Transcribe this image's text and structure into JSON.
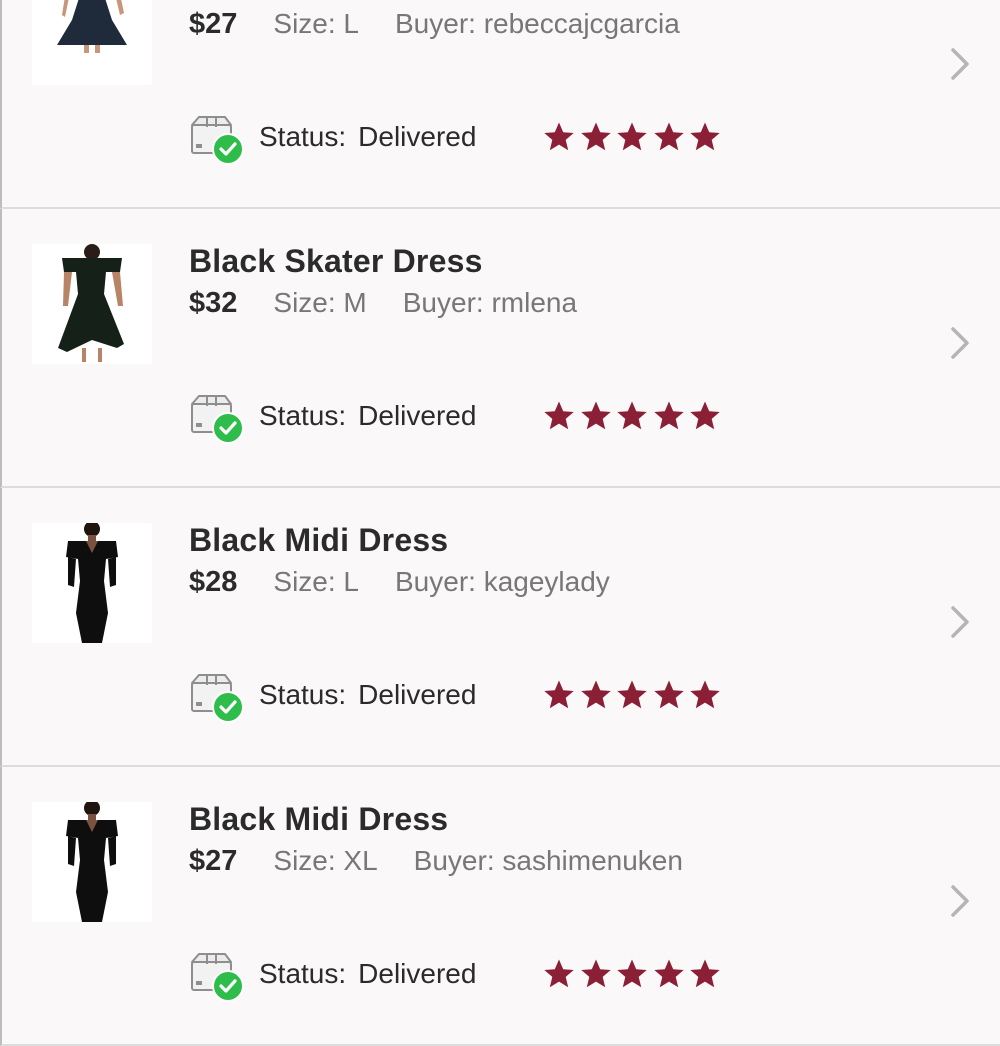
{
  "status_label": "Status:",
  "size_label": "Size:",
  "buyer_label": "Buyer:",
  "colors": {
    "star": "#8b1f35",
    "check": "#2ebd4b",
    "text": "#2b2b2b",
    "meta": "#777777"
  },
  "orders": [
    {
      "title": "",
      "price": "$27",
      "size": "L",
      "buyer": "rebeccajcgarcia",
      "status": "Delivered",
      "rating": 5,
      "thumb_icon": "dress-fit-flare-thumbnail"
    },
    {
      "title": "Black Skater Dress",
      "price": "$32",
      "size": "M",
      "buyer": "rmlena",
      "status": "Delivered",
      "rating": 5,
      "thumb_icon": "dress-skater-thumbnail"
    },
    {
      "title": "Black Midi Dress",
      "price": "$28",
      "size": "L",
      "buyer": "kageylady",
      "status": "Delivered",
      "rating": 5,
      "thumb_icon": "dress-midi-thumbnail"
    },
    {
      "title": "Black Midi Dress",
      "price": "$27",
      "size": "XL",
      "buyer": "sashimenuken",
      "status": "Delivered",
      "rating": 5,
      "thumb_icon": "dress-midi-thumbnail"
    }
  ]
}
